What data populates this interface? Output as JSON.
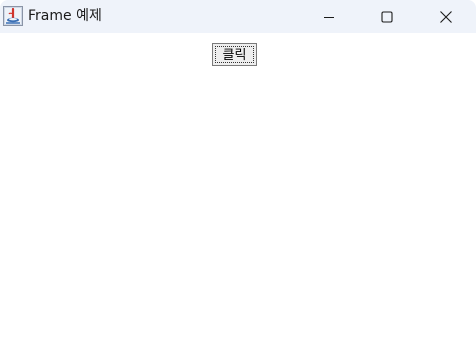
{
  "window": {
    "title": "Frame 예제",
    "app_icon": "java-icon",
    "controls": {
      "minimize": "minimize-icon",
      "maximize": "maximize-icon",
      "close": "close-icon"
    }
  },
  "main": {
    "button_label": "클릭"
  },
  "colors": {
    "titlebar_bg": "#eff3fa",
    "content_bg": "#ffffff",
    "button_bg": "#eeeeee",
    "button_border": "#7a7a7a"
  }
}
